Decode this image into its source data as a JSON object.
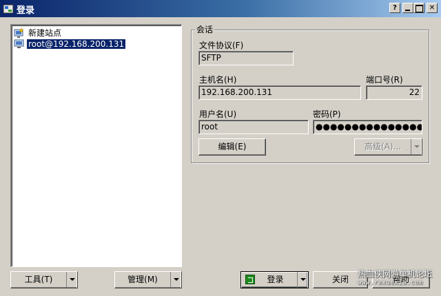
{
  "window": {
    "title": "登录",
    "help_button": "?"
  },
  "tree": {
    "items": [
      {
        "label": "新建站点",
        "selected": false
      },
      {
        "label": "root@192.168.200.131",
        "selected": true
      }
    ]
  },
  "session": {
    "legend": "会话",
    "protocol_label": "文件协议(F)",
    "protocol_value": "SFTP",
    "host_label": "主机名(H)",
    "host_value": "192.168.200.131",
    "port_label": "端口号(R)",
    "port_value": "22",
    "user_label": "用户名(U)",
    "user_value": "root",
    "password_label": "密码(P)",
    "password_value": "●●●●●●●●●●●●●●●●",
    "edit_button": "编辑(E)",
    "advanced_button": "高级(A)..."
  },
  "footer": {
    "tools_button": "工具(T)",
    "manage_button": "管理(M)",
    "login_button": "登录",
    "close_button": "关闭",
    "help_button": "帮助"
  },
  "watermark": {
    "text": "热血侠网游单机论坛",
    "url": "www.rexuexia.com"
  },
  "colors": {
    "titlebar_start": "#0a246a",
    "titlebar_end": "#a6caf0",
    "face": "#d4d0c8",
    "selection": "#0a246a"
  }
}
